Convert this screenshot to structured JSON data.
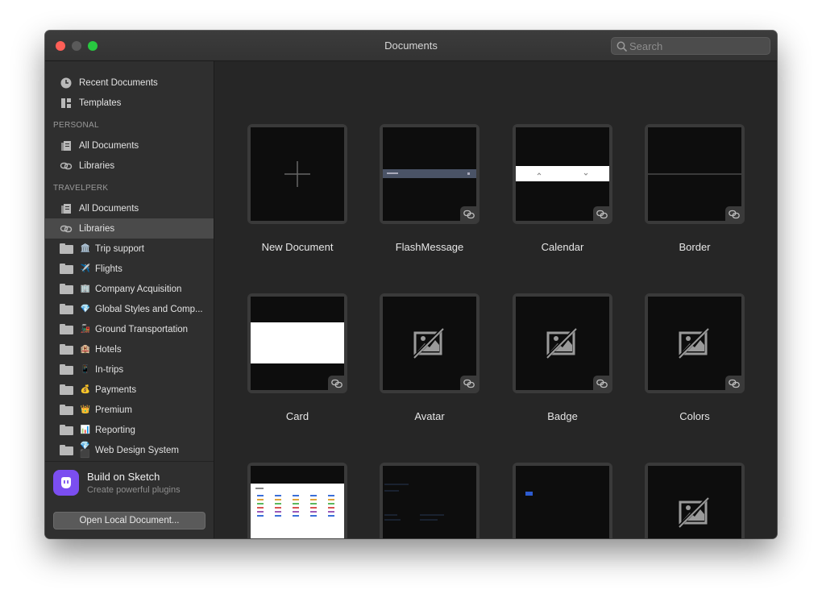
{
  "window": {
    "title": "Documents"
  },
  "search": {
    "placeholder": "Search"
  },
  "sidebar": {
    "top_items": [
      {
        "label": "Recent Documents",
        "icon": "clock-icon"
      },
      {
        "label": "Templates",
        "icon": "templates-icon"
      }
    ],
    "sections": [
      {
        "heading": "PERSONAL",
        "items": [
          {
            "label": "All Documents",
            "icon": "documents-icon"
          },
          {
            "label": "Libraries",
            "icon": "link-icon"
          }
        ]
      },
      {
        "heading": "TRAVELPERK",
        "items": [
          {
            "label": "All Documents",
            "icon": "documents-icon"
          },
          {
            "label": "Libraries",
            "icon": "link-icon",
            "selected": true
          }
        ]
      }
    ],
    "folders": [
      {
        "label": "Trip support",
        "emoji": "🏛️"
      },
      {
        "label": "Flights",
        "emoji": "✈️"
      },
      {
        "label": "Company Acquisition",
        "emoji": "🏢"
      },
      {
        "label": "Global Styles and Comp...",
        "emoji": "💎"
      },
      {
        "label": "Ground Transportation",
        "emoji": "🚂"
      },
      {
        "label": "Hotels",
        "emoji": "🏨"
      },
      {
        "label": "In-trips",
        "emoji": "📱"
      },
      {
        "label": "Payments",
        "emoji": "💰"
      },
      {
        "label": "Premium",
        "emoji": "👑"
      },
      {
        "label": "Reporting",
        "emoji": "📊"
      },
      {
        "label": "Web Design System",
        "emoji": "💎 ⬛"
      }
    ],
    "promo": {
      "title": "Build on Sketch",
      "subtitle": "Create powerful plugins"
    },
    "open_button": "Open Local Document..."
  },
  "documents": [
    {
      "label": "New Document",
      "thumb": "new"
    },
    {
      "label": "FlashMessage",
      "thumb": "flash"
    },
    {
      "label": "Calendar",
      "thumb": "calendar"
    },
    {
      "label": "Border",
      "thumb": "border"
    },
    {
      "label": "Card",
      "thumb": "card"
    },
    {
      "label": "Avatar",
      "thumb": "placeholder"
    },
    {
      "label": "Badge",
      "thumb": "placeholder"
    },
    {
      "label": "Colors",
      "thumb": "placeholder"
    },
    {
      "label": "",
      "thumb": "table"
    },
    {
      "label": "",
      "thumb": "dark-text"
    },
    {
      "label": "",
      "thumb": "blue-dot"
    },
    {
      "label": "",
      "thumb": "placeholder"
    }
  ],
  "colors": {
    "selection": "#4a4a4a",
    "promo_logo": "#7b4ef0",
    "close": "#ff5f57",
    "maximize": "#28c840"
  }
}
